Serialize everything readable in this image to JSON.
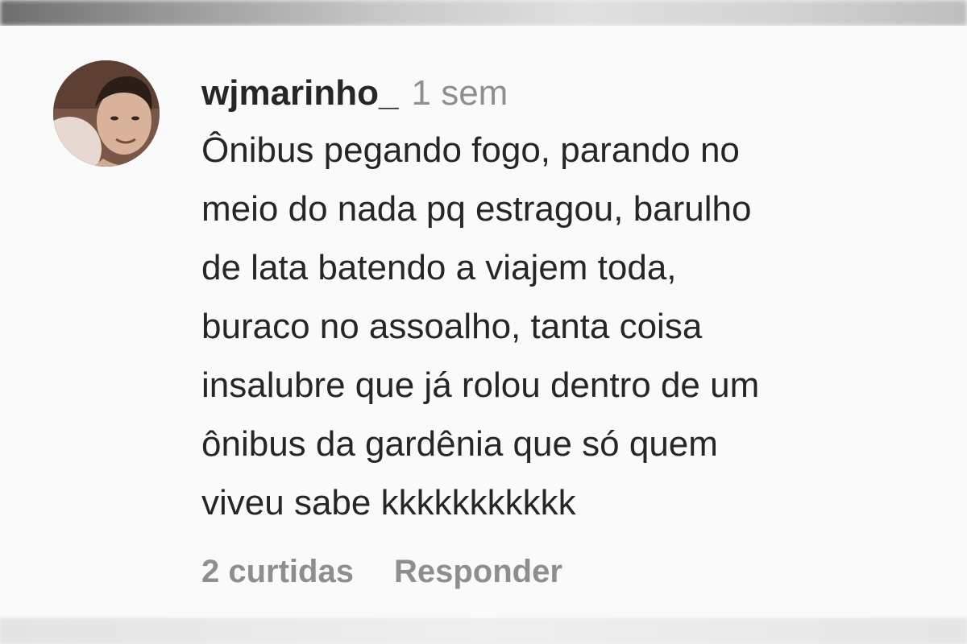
{
  "comment": {
    "username": "wjmarinho_",
    "time": "1 sem",
    "lines": [
      "Ônibus pegando fogo, parando no",
      "meio do nada pq estragou, barulho",
      "de lata batendo a viajem toda,",
      "buraco no assoalho, tanta coisa",
      "insalubre que já rolou dentro de um",
      "ônibus da gardênia que só quem",
      "viveu sabe kkkkkkkkkkk"
    ],
    "likes_label": "2 curtidas",
    "reply_label": "Responder"
  },
  "colors": {
    "primary_text": "#262626",
    "secondary_text": "#8e8e8e",
    "background": "#fafafa"
  }
}
